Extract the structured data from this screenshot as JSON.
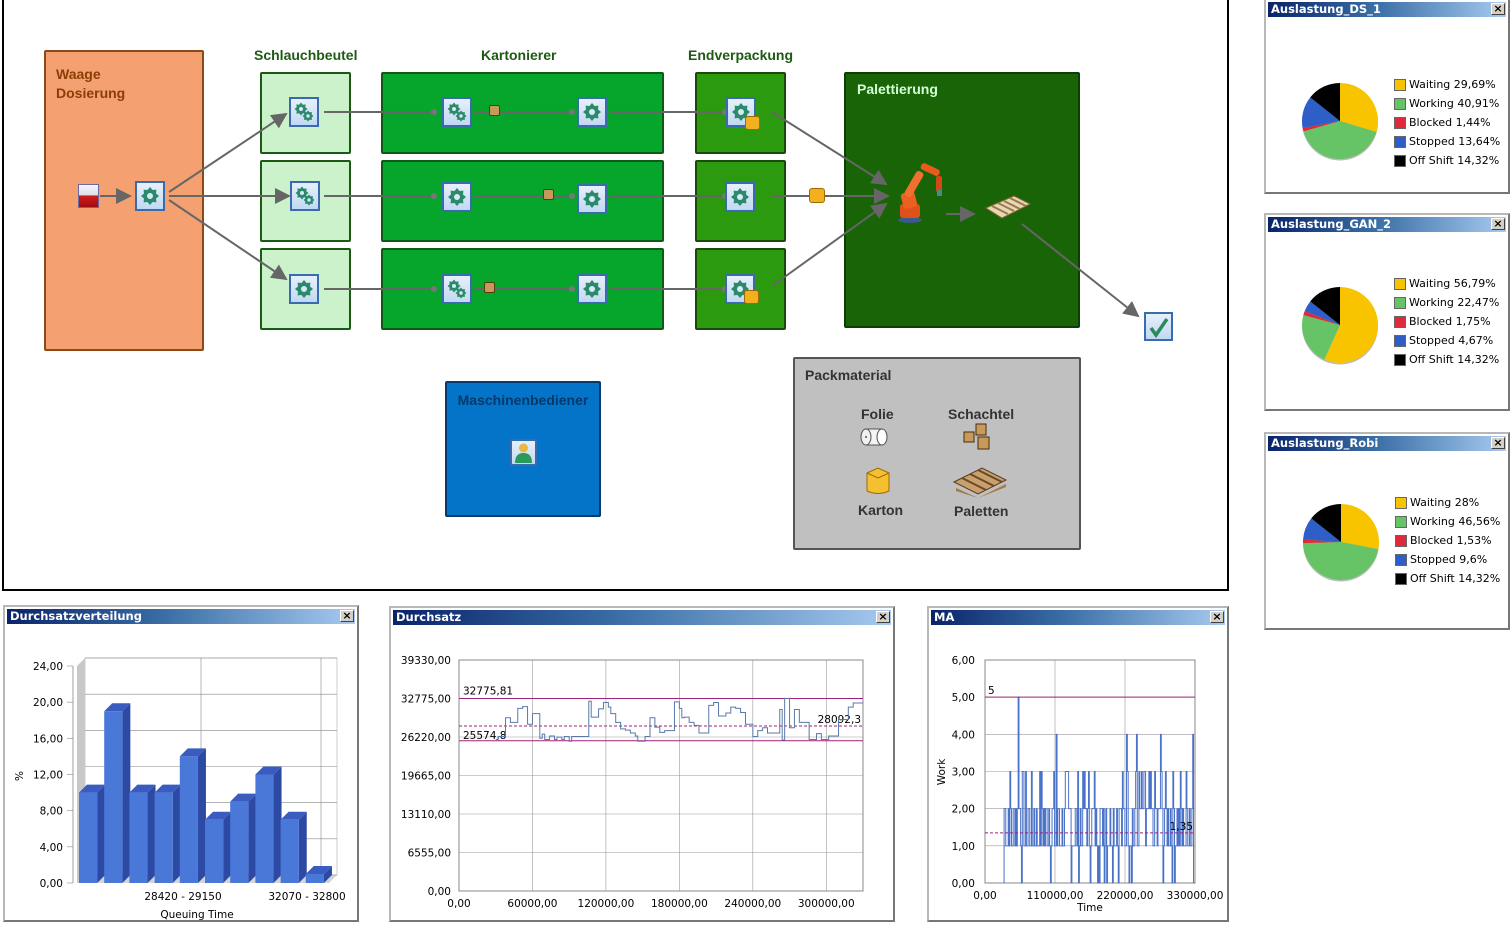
{
  "model": {
    "groups": {
      "waage": "Waage\nDosierung",
      "schlauchbeutel": "Schlauchbeutel",
      "kartonierer": "Kartonierer",
      "endverpackung": "Endverpackung",
      "palettierung": "Palettierung",
      "maschinenbediener": "Maschinenbediener",
      "packmaterial": "Packmaterial"
    },
    "packmaterial_items": [
      "Folie",
      "Schachtel",
      "Karton",
      "Paletten"
    ]
  },
  "pie_windows": [
    {
      "title": "Auslastung_DS_1",
      "slices": [
        {
          "label": "Waiting",
          "value": 29.69,
          "text": "Waiting 29,69%",
          "color": "#f8c400"
        },
        {
          "label": "Working",
          "value": 40.91,
          "text": "Working 40,91%",
          "color": "#66c466"
        },
        {
          "label": "Blocked",
          "value": 1.44,
          "text": "Blocked 1,44%",
          "color": "#e02a3a"
        },
        {
          "label": "Stopped",
          "value": 13.64,
          "text": "Stopped 13,64%",
          "color": "#2e5ec8"
        },
        {
          "label": "Off Shift",
          "value": 14.32,
          "text": "Off Shift 14,32%",
          "color": "#000000"
        }
      ]
    },
    {
      "title": "Auslastung_GAN_2",
      "slices": [
        {
          "label": "Waiting",
          "value": 56.79,
          "text": "Waiting 56,79%",
          "color": "#f8c400"
        },
        {
          "label": "Working",
          "value": 22.47,
          "text": "Working 22,47%",
          "color": "#66c466"
        },
        {
          "label": "Blocked",
          "value": 1.75,
          "text": "Blocked 1,75%",
          "color": "#e02a3a"
        },
        {
          "label": "Stopped",
          "value": 4.67,
          "text": "Stopped 4,67%",
          "color": "#2e5ec8"
        },
        {
          "label": "Off Shift",
          "value": 14.32,
          "text": "Off Shift 14,32%",
          "color": "#000000"
        }
      ]
    },
    {
      "title": "Auslastung_Robi",
      "slices": [
        {
          "label": "Waiting",
          "value": 28,
          "text": "Waiting 28%",
          "color": "#f8c400"
        },
        {
          "label": "Working",
          "value": 46.56,
          "text": "Working 46,56%",
          "color": "#66c466"
        },
        {
          "label": "Blocked",
          "value": 1.53,
          "text": "Blocked 1,53%",
          "color": "#e02a3a"
        },
        {
          "label": "Stopped",
          "value": 9.6,
          "text": "Stopped 9,6%",
          "color": "#2e5ec8"
        },
        {
          "label": "Off Shift",
          "value": 14.32,
          "text": "Off Shift 14,32%",
          "color": "#000000"
        }
      ]
    }
  ],
  "chart_data": [
    {
      "type": "bar",
      "window_title": "Durchsatzverteilung",
      "title": "Durchsatzverteilung",
      "xlabel": "Queuing Time",
      "ylabel": "%",
      "ylim": [
        0,
        24
      ],
      "yticks": [
        "0,00",
        "4,00",
        "8,00",
        "12,00",
        "16,00",
        "20,00",
        "24,00"
      ],
      "xtick_labels": [
        "28420 - 29150",
        "32070 - 32800"
      ],
      "categories": [
        "1",
        "2",
        "3",
        "4",
        "5",
        "6",
        "7",
        "8",
        "9",
        "10"
      ],
      "values": [
        10,
        19,
        10,
        10,
        14,
        7,
        9,
        12,
        7,
        1
      ],
      "bar_color": "#4a78d8",
      "grid": true
    },
    {
      "type": "line",
      "window_title": "Durchsatz",
      "title": "Durchsatz",
      "xlabel": "",
      "ylabel": "",
      "xlim": [
        0,
        330000
      ],
      "ylim": [
        0,
        39330
      ],
      "xticks": [
        "0,00",
        "60000,00",
        "120000,00",
        "180000,00",
        "240000,00",
        "300000,00"
      ],
      "yticks": [
        "0,00",
        "6555,00",
        "13110,00",
        "19665,00",
        "26220,00",
        "32775,00",
        "39330,00"
      ],
      "reference_lines": [
        {
          "label": "32775,81",
          "value": 32775.81,
          "style": "solid"
        },
        {
          "label": "28092,3",
          "value": 28092.3,
          "style": "dashed"
        },
        {
          "label": "25574,8",
          "value": 25574.8,
          "style": "solid"
        }
      ],
      "series": [
        {
          "name": "Durchsatz",
          "x": [
            30000,
            32000,
            38000,
            42000,
            48000,
            52000,
            56000,
            60000,
            66000,
            68000,
            70000,
            74000,
            78000,
            80000,
            84000,
            86000,
            90000,
            92000,
            100000,
            106000,
            108000,
            112000,
            114000,
            118000,
            122000,
            124000,
            128000,
            132000,
            136000,
            140000,
            144000,
            146000,
            150000,
            152000,
            156000,
            160000,
            164000,
            168000,
            172000,
            176000,
            180000,
            182000,
            184000,
            188000,
            192000,
            196000,
            200000,
            204000,
            208000,
            212000,
            214000,
            218000,
            222000,
            226000,
            230000,
            234000,
            238000,
            240000,
            244000,
            248000,
            252000,
            256000,
            262000,
            264000,
            266000,
            270000,
            272000,
            274000,
            278000,
            282000,
            286000,
            288000,
            292000,
            296000,
            300000,
            302000,
            308000,
            310000,
            318000,
            322000,
            330000
          ],
          "y": [
            25800,
            26300,
            29500,
            28700,
            31100,
            31400,
            28400,
            30200,
            26000,
            26700,
            25800,
            26400,
            25800,
            26200,
            25800,
            26300,
            25500,
            26300,
            26300,
            32300,
            29600,
            29600,
            31000,
            32100,
            31300,
            30200,
            28700,
            27600,
            27400,
            26900,
            26400,
            25500,
            25500,
            26300,
            29500,
            27900,
            27000,
            27300,
            27300,
            32200,
            31100,
            29500,
            29600,
            28700,
            28200,
            26900,
            26900,
            31600,
            32100,
            29800,
            29800,
            30300,
            31300,
            31100,
            30400,
            28400,
            28400,
            26300,
            27300,
            27800,
            26900,
            26900,
            30900,
            25700,
            32800,
            27800,
            27800,
            30900,
            28700,
            28700,
            25800,
            25800,
            26800,
            25800,
            25800,
            26400,
            26400,
            29200,
            31300,
            32000,
            32000
          ],
          "color": "#5a7aa8"
        }
      ],
      "grid": true
    },
    {
      "type": "line",
      "window_title": "MA",
      "title": "MA",
      "xlabel": "Time",
      "ylabel": "Work",
      "xlim": [
        0,
        330000
      ],
      "ylim": [
        0,
        6
      ],
      "xticks": [
        "0,00",
        "110000,00",
        "220000,00",
        "330000,00"
      ],
      "yticks": [
        "0,00",
        "1,00",
        "2,00",
        "3,00",
        "4,00",
        "5,00",
        "6,00"
      ],
      "reference_lines": [
        {
          "label": "5",
          "value": 5,
          "style": "solid"
        },
        {
          "label": "1,35",
          "value": 1.35,
          "style": "dashed"
        }
      ],
      "series": [
        {
          "name": "Work",
          "description": "step series oscillating mostly between 1 and 3 from ~30000 to 330000, with occasional peaks to 4 and 5 and drops to 0",
          "x_start": 30000,
          "x_end": 330000,
          "min": 0,
          "max": 5,
          "typical_band": [
            1,
            3
          ],
          "peaks": [
            {
              "x": 52000,
              "y": 5
            },
            {
              "x": 112000,
              "y": 4
            },
            {
              "x": 222000,
              "y": 4
            },
            {
              "x": 238000,
              "y": 4
            },
            {
              "x": 276000,
              "y": 4
            },
            {
              "x": 326000,
              "y": 4
            }
          ],
          "color": "#4a72c8"
        }
      ],
      "grid": true
    }
  ]
}
